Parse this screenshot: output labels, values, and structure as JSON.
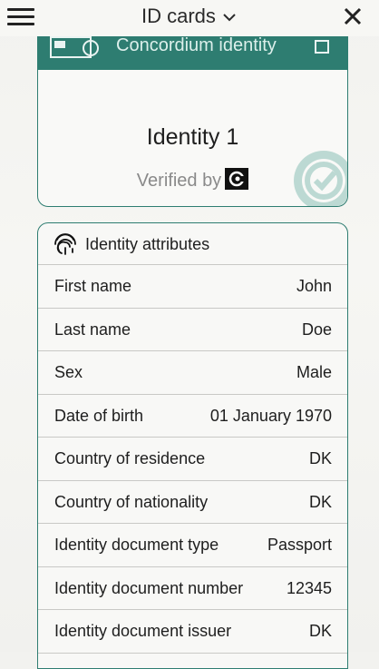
{
  "header": {
    "title": "ID cards"
  },
  "card": {
    "provider": "Concordium identity",
    "name": "Identity 1",
    "verified_label": "Verified by"
  },
  "attributes": {
    "title": "Identity attributes",
    "rows": [
      {
        "label": "First name",
        "value": "John"
      },
      {
        "label": "Last name",
        "value": "Doe"
      },
      {
        "label": "Sex",
        "value": "Male"
      },
      {
        "label": "Date of birth",
        "value": "01 January 1970"
      },
      {
        "label": "Country of residence",
        "value": "DK"
      },
      {
        "label": "Country of nationality",
        "value": "DK"
      },
      {
        "label": "Identity document type",
        "value": "Passport"
      },
      {
        "label": "Identity document number",
        "value": "12345"
      },
      {
        "label": "Identity document issuer",
        "value": "DK"
      },
      {
        "label": "",
        "value": ""
      }
    ]
  },
  "colors": {
    "accent": "#2e7d71",
    "divider": "#c9c9c6"
  }
}
